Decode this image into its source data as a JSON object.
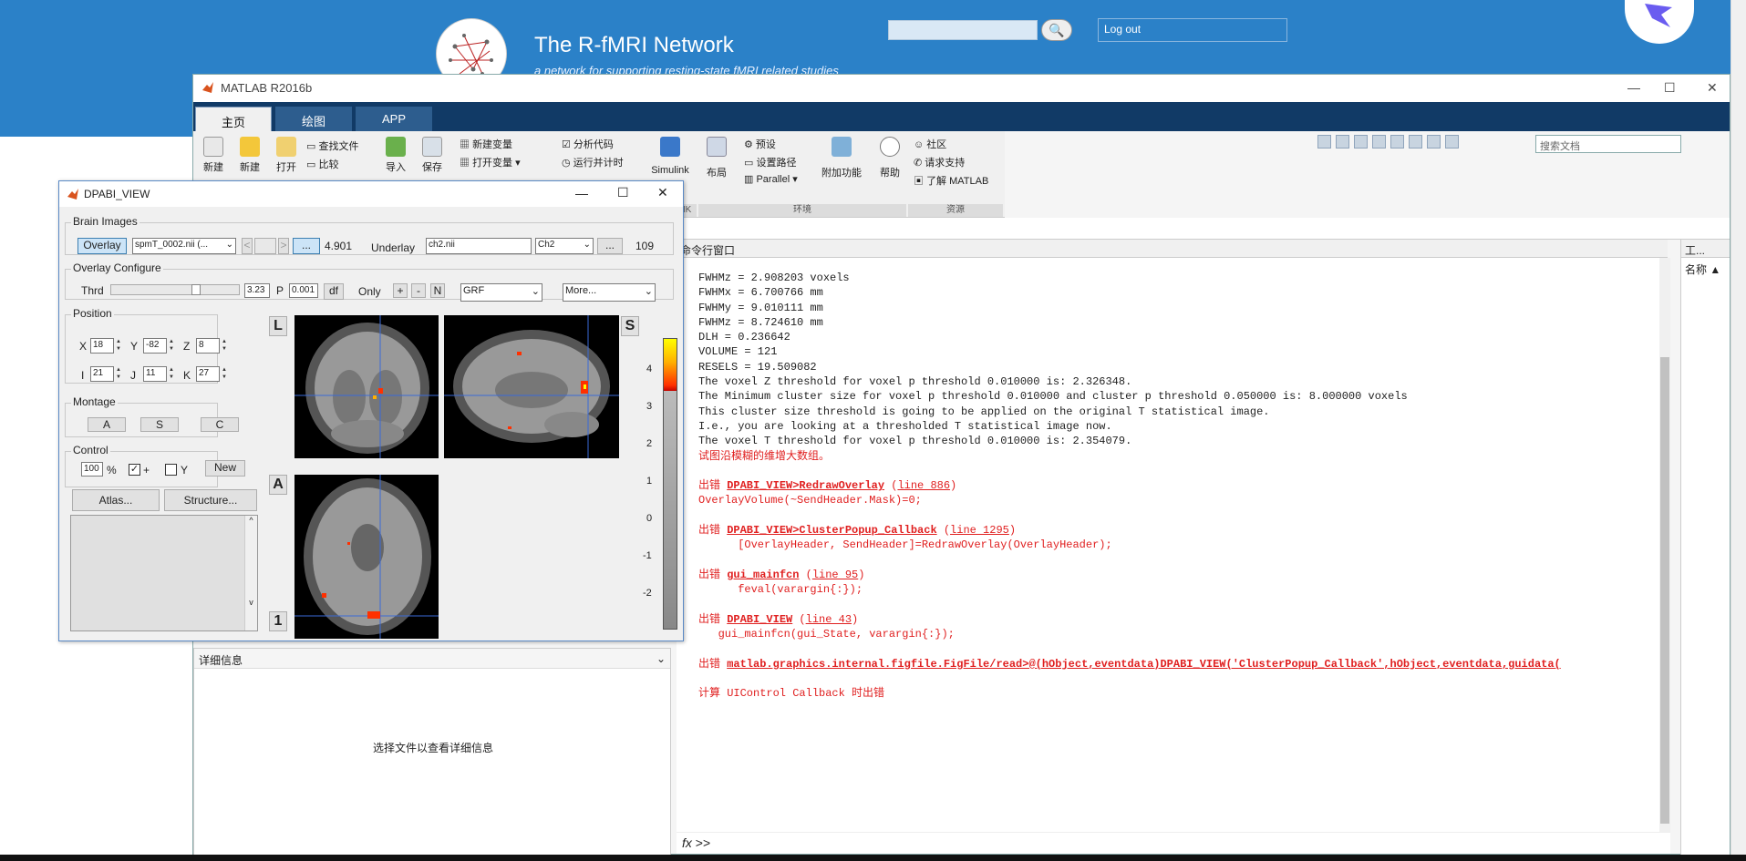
{
  "website": {
    "title": "The R-fMRI Network",
    "subtitle": "a network for supporting resting-state fMRI related studies",
    "search_button": "🔍",
    "logout": "Log out"
  },
  "matlab": {
    "window_title": "MATLAB R2016b",
    "controls": {
      "min": "—",
      "max": "☐",
      "close": "✕"
    },
    "tabs": [
      "主页",
      "绘图",
      "APP"
    ],
    "toolstrip": {
      "new_script": "新建",
      "new": "新建",
      "open": "打开",
      "find_files": "查找文件",
      "compare": "比较",
      "import": "导入",
      "save": "保存",
      "new_variable": "新建变量",
      "open_variable": "打开变量",
      "analyze_code": "分析代码",
      "run_and_time": "运行并计时",
      "simulink": "Simulink",
      "layout": "布局",
      "preferences": "预设",
      "set_path": "设置路径",
      "parallel": "Parallel",
      "addons": "附加功能",
      "help": "帮助",
      "community": "社区",
      "request_support": "请求支持",
      "learn_matlab": "了解 MATLAB"
    },
    "sections": {
      "simulink": "INK",
      "environment": "环境",
      "resources": "资源"
    },
    "doc_search_placeholder": "搜索文档",
    "command_window_title": "命令行窗口",
    "workspace_title": "工...",
    "workspace_col": "名称 ▲",
    "details_title": "详细信息",
    "details_empty": "选择文件以查看详细信息",
    "prompt": ">>",
    "fx": "fx"
  },
  "command_window": {
    "lines": [
      {
        "t": "FWHMz = 2.908203 voxels",
        "c": "n"
      },
      {
        "t": "FWHMx = 6.700766 mm",
        "c": "n"
      },
      {
        "t": "FWHMy = 9.010111 mm",
        "c": "n"
      },
      {
        "t": "FWHMz = 8.724610 mm",
        "c": "n"
      },
      {
        "t": "DLH = 0.236642",
        "c": "n"
      },
      {
        "t": "VOLUME = 121",
        "c": "n"
      },
      {
        "t": "RESELS = 19.509082",
        "c": "n"
      },
      {
        "t": "The voxel Z threshold for voxel p threshold 0.010000 is: 2.326348.",
        "c": "n"
      },
      {
        "t": "The Minimum cluster size for voxel p threshold 0.010000 and cluster p threshold 0.050000 is: 8.000000 voxels",
        "c": "n"
      },
      {
        "t": "This cluster size threshold is going to be applied on the original T statistical image.",
        "c": "n"
      },
      {
        "t": "I.e., you are looking at a thresholded T statistical image now.",
        "c": "n"
      },
      {
        "t": "The voxel T threshold for voxel p threshold 0.010000 is: 2.354079.",
        "c": "n"
      },
      {
        "t": "试图沿模糊的维增大数组。",
        "c": "e"
      },
      {
        "t": "",
        "c": "n"
      },
      {
        "pre": "出错 ",
        "fn": "DPABI_VIEW>RedrawOverlay",
        "ln": "line 886",
        "c": "h"
      },
      {
        "t": "OverlayVolume(~SendHeader.Mask)=0;",
        "c": "e"
      },
      {
        "t": "",
        "c": "n"
      },
      {
        "pre": "出错 ",
        "fn": "DPABI_VIEW>ClusterPopup_Callback",
        "ln": "line 1295",
        "c": "h"
      },
      {
        "t": "      [OverlayHeader, SendHeader]=RedrawOverlay(OverlayHeader);",
        "c": "e"
      },
      {
        "t": "",
        "c": "n"
      },
      {
        "pre": "出错 ",
        "fn": "gui_mainfcn",
        "ln": "line 95",
        "c": "h"
      },
      {
        "t": "      feval(varargin{:});",
        "c": "e"
      },
      {
        "t": "",
        "c": "n"
      },
      {
        "pre": "出错 ",
        "fn": "DPABI_VIEW",
        "ln": "line 43",
        "c": "h"
      },
      {
        "t": "   gui_mainfcn(gui_State, varargin{:});",
        "c": "e"
      },
      {
        "t": "",
        "c": "n"
      },
      {
        "pre": "出错 ",
        "fn": "matlab.graphics.internal.figfile.FigFile/read>@(hObject,eventdata)DPABI_VIEW('ClusterPopup_Callback',hObject,eventdata,guidata(",
        "ln": "",
        "c": "h"
      },
      {
        "t": "",
        "c": "n"
      },
      {
        "t": "计算 UIControl Callback 时出错",
        "c": "e"
      }
    ]
  },
  "dpabi": {
    "title": "DPABI_VIEW",
    "brain_images_label": "Brain Images",
    "overlay_btn": "Overlay",
    "overlay_file": "spmT_0002.nii (...",
    "prev": "<",
    "next": ">",
    "dots": "...",
    "overlay_value": "4.901",
    "underlay_label": "Underlay",
    "underlay_file": "ch2.nii",
    "underlay_template": "Ch2",
    "underlay_value": "109",
    "overlay_configure_label": "Overlay Configure",
    "thrd_label": "Thrd",
    "thrd_value": "3.23",
    "p_label": "P",
    "p_value": "0.001",
    "df_btn": "df",
    "only_label": "Only",
    "plus": "+",
    "minus": "-",
    "n_btn": "N",
    "correction": "GRF",
    "more": "More...",
    "position_label": "Position",
    "x_label": "X",
    "x_value": "18",
    "y_label": "Y",
    "y_value": "-82",
    "z_label": "Z",
    "z_value": "8",
    "i_label": "I",
    "i_value": "21",
    "j_label": "J",
    "j_value": "11",
    "k_label": "K",
    "k_value": "27",
    "montage_label": "Montage",
    "montage_a": "A",
    "montage_s": "S",
    "montage_c": "C",
    "control_label": "Control",
    "zoom_value": "100",
    "percent": "%",
    "crosshair_label": "+",
    "y_check_label": "Y",
    "new_btn": "New",
    "atlas_btn": "Atlas...",
    "structure_btn": "Structure...",
    "view_l": "L",
    "view_s": "S",
    "view_a": "A",
    "view_1": "1",
    "colorbar_ticks": [
      "4",
      "3",
      "2",
      "1",
      "0",
      "-1",
      "-2"
    ]
  }
}
